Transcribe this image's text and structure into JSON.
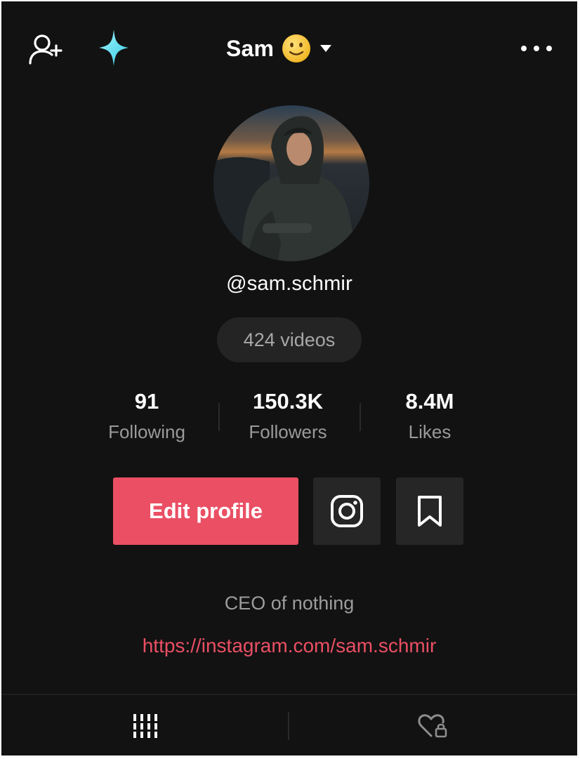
{
  "header": {
    "title": "Sam",
    "icons": {
      "add_user": "add-user-icon",
      "sparkle": "sparkle-icon",
      "emoji": "slightly-smiling-face-emoji",
      "dropdown": "caret-down-icon",
      "more": "more-options-icon"
    }
  },
  "profile": {
    "handle": "@sam.schmir",
    "videos_label": "424 videos",
    "bio": "CEO of nothing",
    "link": "https://instagram.com/sam.schmir"
  },
  "stats": [
    {
      "value": "91",
      "label": "Following"
    },
    {
      "value": "150.3K",
      "label": "Followers"
    },
    {
      "value": "8.4M",
      "label": "Likes"
    }
  ],
  "actions": {
    "edit_label": "Edit profile",
    "icons": {
      "instagram": "instagram-icon",
      "bookmark": "bookmark-icon"
    }
  },
  "tabs": {
    "icons": {
      "videos": "grid-bars-icon",
      "liked": "heart-lock-icon"
    }
  },
  "colors": {
    "background": "#121212",
    "accent": "#ea4f64",
    "surface": "#262626",
    "pill": "#242424",
    "sparkle": "#5fe3ee",
    "muted_text": "#9d9d9d"
  }
}
